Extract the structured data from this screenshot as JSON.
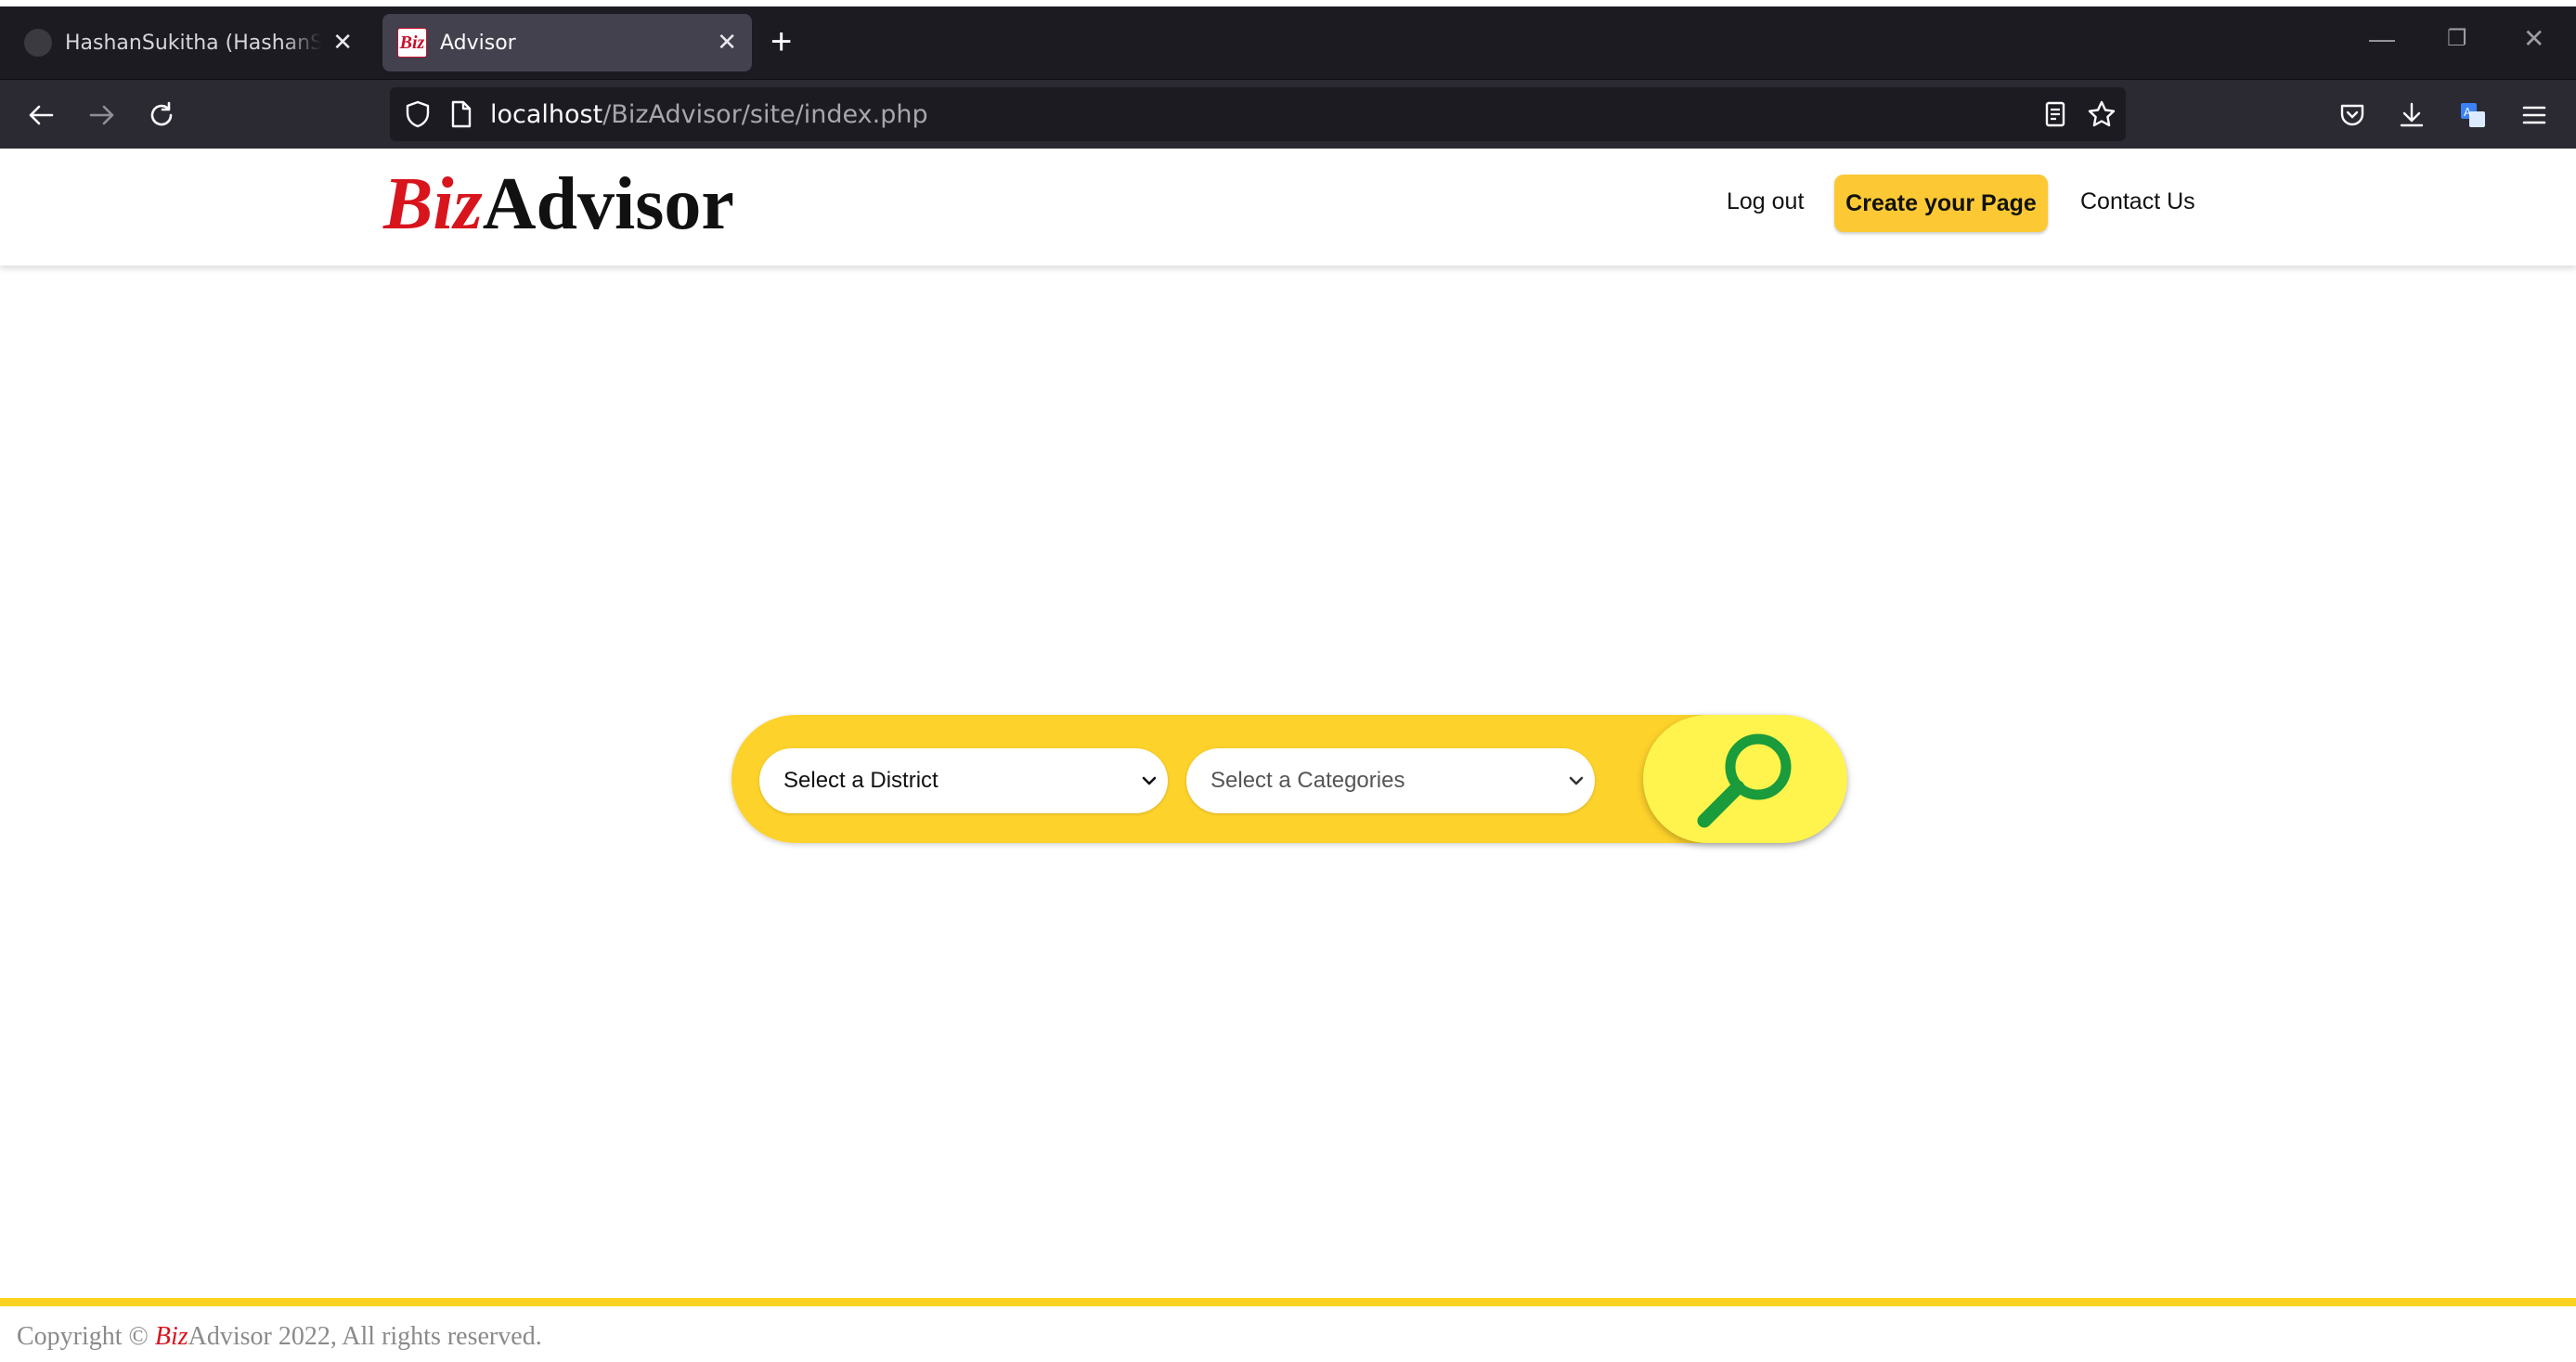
{
  "browser": {
    "tabs": [
      {
        "title": "HashanSukitha (HashanSukitha)",
        "active": false
      },
      {
        "title": "Advisor",
        "active": true,
        "favicon_text": "Biz"
      }
    ],
    "url": {
      "host": "localhost",
      "path": "/BizAdvisor/site/index.php"
    }
  },
  "site": {
    "logo": {
      "part1": "Biz",
      "part2": "Advisor"
    },
    "nav": {
      "logout": "Log out",
      "create_page": "Create your Page",
      "contact": "Contact Us"
    },
    "search": {
      "district_select": "Select a District",
      "category_select": "Select a Categories"
    },
    "footer": {
      "prefix": "Copyright © ",
      "brand1": "Biz",
      "brand2": "Advisor 2022, All rights reserved."
    }
  },
  "colors": {
    "brand_red": "#d8141d",
    "accent_yellow": "#fdd22b",
    "cta_yellow": "#fcc934",
    "search_green": "#1a9b3c"
  }
}
